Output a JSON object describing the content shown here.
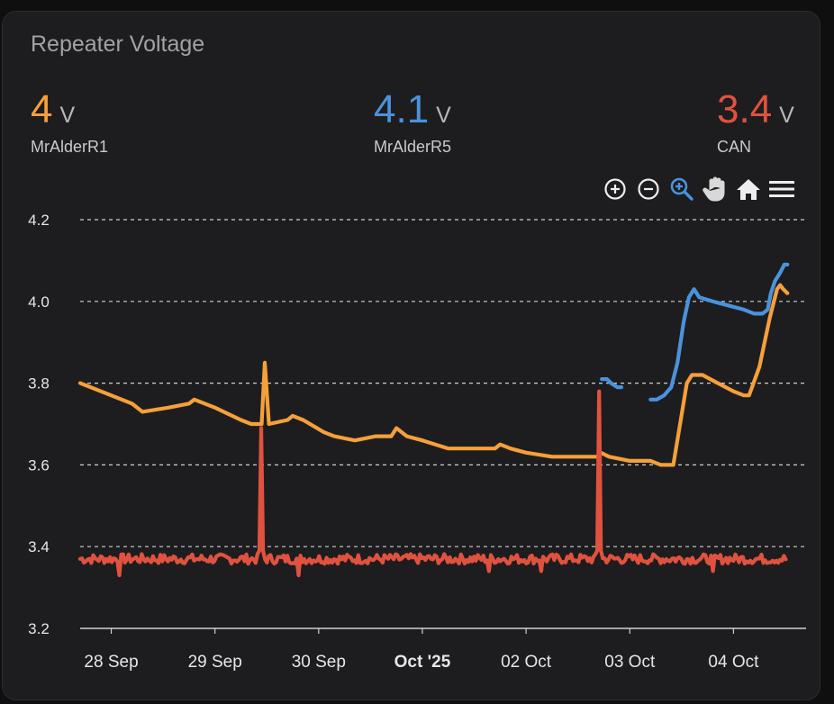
{
  "card": {
    "title": "Repeater Voltage"
  },
  "entities": [
    {
      "value": "4",
      "unit": "V",
      "name": "MrAlderR1",
      "color": "#f5a03a"
    },
    {
      "value": "4.1",
      "unit": "V",
      "name": "MrAlderR5",
      "color": "#4b92dc"
    },
    {
      "value": "3.4",
      "unit": "V",
      "name": "CAN",
      "color": "#e0523f"
    }
  ],
  "toolbar": {
    "icons": [
      "zoom-in-icon",
      "zoom-out-icon",
      "zoom-selection-icon",
      "pan-hand-icon",
      "home-reset-icon",
      "menu-icon"
    ],
    "active_color": "#4b92dc"
  },
  "chart_data": {
    "type": "line",
    "ylim": [
      3.2,
      4.2
    ],
    "yticks": [
      "4.2",
      "4.0",
      "3.8",
      "3.6",
      "3.4",
      "3.2"
    ],
    "xlim": [
      0,
      7.0
    ],
    "xticks": [
      {
        "x": 0.3,
        "label": "28 Sep",
        "bold": false
      },
      {
        "x": 1.3,
        "label": "29 Sep",
        "bold": false
      },
      {
        "x": 2.3,
        "label": "30 Sep",
        "bold": false
      },
      {
        "x": 3.3,
        "label": "Oct '25",
        "bold": true
      },
      {
        "x": 4.3,
        "label": "02 Oct",
        "bold": false
      },
      {
        "x": 5.3,
        "label": "03 Oct",
        "bold": false
      },
      {
        "x": 6.3,
        "label": "04 Oct",
        "bold": false
      }
    ],
    "grid": true,
    "series": [
      {
        "name": "MrAlderR1",
        "color": "#f5a03a",
        "points": [
          [
            0.0,
            3.8
          ],
          [
            0.3,
            3.77
          ],
          [
            0.5,
            3.75
          ],
          [
            0.6,
            3.73
          ],
          [
            0.85,
            3.74
          ],
          [
            1.05,
            3.75
          ],
          [
            1.1,
            3.76
          ],
          [
            1.2,
            3.75
          ],
          [
            1.3,
            3.74
          ],
          [
            1.55,
            3.71
          ],
          [
            1.65,
            3.7
          ],
          [
            1.75,
            3.7
          ],
          [
            1.78,
            3.85
          ],
          [
            1.82,
            3.7
          ],
          [
            2.0,
            3.71
          ],
          [
            2.05,
            3.72
          ],
          [
            2.15,
            3.71
          ],
          [
            2.35,
            3.68
          ],
          [
            2.45,
            3.67
          ],
          [
            2.65,
            3.66
          ],
          [
            2.85,
            3.67
          ],
          [
            3.0,
            3.67
          ],
          [
            3.05,
            3.69
          ],
          [
            3.15,
            3.67
          ],
          [
            3.3,
            3.66
          ],
          [
            3.55,
            3.64
          ],
          [
            3.8,
            3.64
          ],
          [
            4.0,
            3.64
          ],
          [
            4.05,
            3.65
          ],
          [
            4.15,
            3.64
          ],
          [
            4.3,
            3.63
          ],
          [
            4.55,
            3.62
          ],
          [
            4.8,
            3.62
          ],
          [
            5.0,
            3.62
          ],
          [
            5.02,
            3.63
          ],
          [
            5.1,
            3.62
          ],
          [
            5.3,
            3.61
          ],
          [
            5.5,
            3.61
          ],
          [
            5.6,
            3.6
          ],
          [
            5.72,
            3.6
          ],
          [
            5.85,
            3.8
          ],
          [
            5.9,
            3.82
          ],
          [
            6.0,
            3.82
          ],
          [
            6.15,
            3.8
          ],
          [
            6.3,
            3.78
          ],
          [
            6.4,
            3.77
          ],
          [
            6.45,
            3.77
          ],
          [
            6.55,
            3.84
          ],
          [
            6.65,
            3.96
          ],
          [
            6.72,
            4.03
          ],
          [
            6.75,
            4.04
          ],
          [
            6.78,
            4.03
          ],
          [
            6.82,
            4.02
          ]
        ]
      },
      {
        "name": "MrAlderR5",
        "color": "#4b92dc",
        "segments": [
          [
            [
              5.03,
              3.81
            ],
            [
              5.08,
              3.81
            ],
            [
              5.12,
              3.8
            ],
            [
              5.18,
              3.79
            ],
            [
              5.22,
              3.79
            ]
          ],
          [
            [
              5.5,
              3.76
            ],
            [
              5.56,
              3.76
            ],
            [
              5.63,
              3.77
            ],
            [
              5.7,
              3.79
            ],
            [
              5.76,
              3.85
            ],
            [
              5.82,
              3.95
            ],
            [
              5.87,
              4.01
            ],
            [
              5.92,
              4.03
            ],
            [
              5.97,
              4.01
            ],
            [
              6.1,
              4.0
            ],
            [
              6.25,
              3.99
            ],
            [
              6.4,
              3.98
            ],
            [
              6.5,
              3.97
            ],
            [
              6.58,
              3.97
            ],
            [
              6.63,
              3.98
            ],
            [
              6.66,
              4.02
            ],
            [
              6.7,
              4.05
            ],
            [
              6.75,
              4.07
            ],
            [
              6.79,
              4.09
            ],
            [
              6.82,
              4.09
            ]
          ]
        ]
      },
      {
        "name": "CAN",
        "color": "#e0523f",
        "baseline": 3.37,
        "noise": 0.012,
        "spikes": [
          {
            "x": 1.75,
            "y": 3.69
          },
          {
            "x": 5.0,
            "y": 3.78
          }
        ],
        "dips": [
          {
            "x": 0.38,
            "y": 3.33
          },
          {
            "x": 2.1,
            "y": 3.33
          },
          {
            "x": 3.95,
            "y": 3.34
          },
          {
            "x": 4.45,
            "y": 3.34
          },
          {
            "x": 6.1,
            "y": 3.34
          }
        ],
        "xend": 6.82
      }
    ]
  }
}
